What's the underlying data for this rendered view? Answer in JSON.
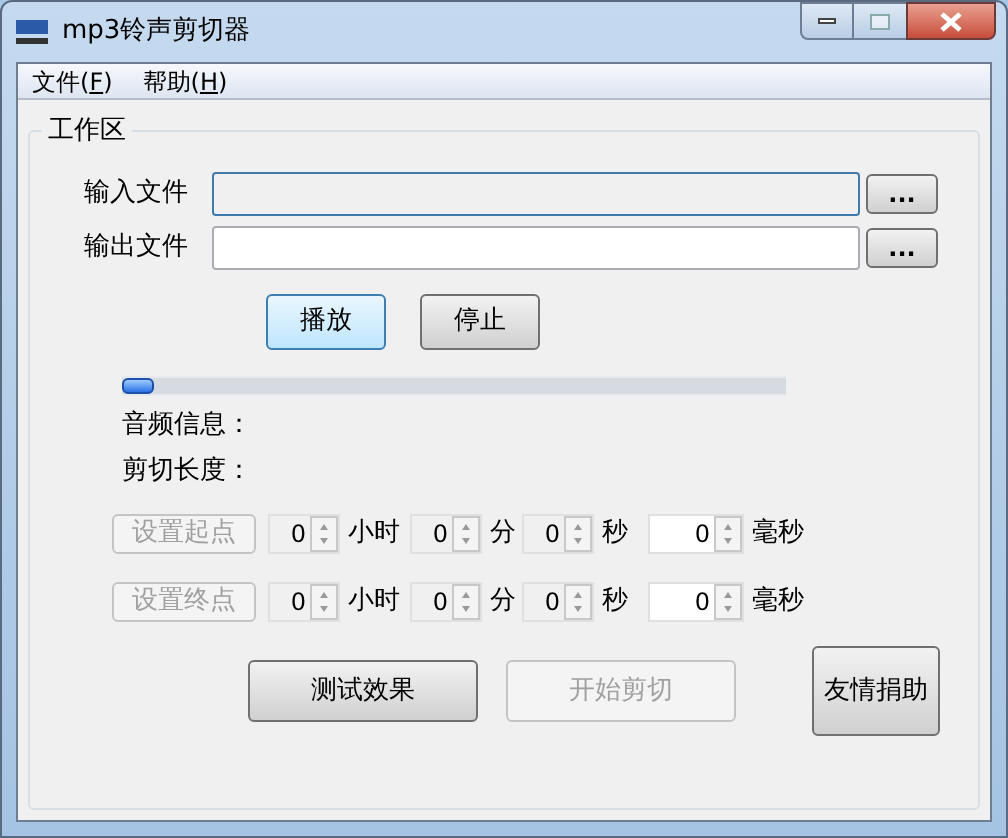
{
  "window": {
    "title": "mp3铃声剪切器"
  },
  "menu": [
    {
      "before": "文件(",
      "mnemonic": "F",
      "after": ")"
    },
    {
      "before": "帮助(",
      "mnemonic": "H",
      "after": ")"
    }
  ],
  "group": {
    "title": "工作区"
  },
  "file_fields": [
    {
      "label": "输入文件",
      "focused": true,
      "browse": "..."
    },
    {
      "label": "输出文件",
      "focused": false,
      "browse": "..."
    }
  ],
  "playback_buttons": [
    {
      "label": "播放",
      "highlighted": true
    },
    {
      "label": "停止",
      "highlighted": false
    }
  ],
  "slider": {
    "level": 0
  },
  "info_labels": [
    "音频信息：",
    "剪切长度："
  ],
  "time_rows": [
    {
      "button": {
        "label": "设置起点",
        "disabled": true
      },
      "fields": [
        {
          "value": "0",
          "unit": "小时",
          "disabled": true
        },
        {
          "value": "0",
          "unit": "分",
          "disabled": true
        },
        {
          "value": "0",
          "unit": "秒",
          "disabled": true
        },
        {
          "value": "0",
          "unit": "毫秒",
          "disabled": false
        }
      ]
    },
    {
      "button": {
        "label": "设置终点",
        "disabled": true
      },
      "fields": [
        {
          "value": "0",
          "unit": "小时",
          "disabled": true
        },
        {
          "value": "0",
          "unit": "分",
          "disabled": true
        },
        {
          "value": "0",
          "unit": "秒",
          "disabled": true
        },
        {
          "value": "0",
          "unit": "毫秒",
          "disabled": false
        }
      ]
    }
  ],
  "action_buttons": [
    {
      "label": "测试效果",
      "disabled": false
    },
    {
      "label": "开始剪切",
      "disabled": true
    }
  ],
  "donate_button": {
    "label": "友情捐助"
  }
}
